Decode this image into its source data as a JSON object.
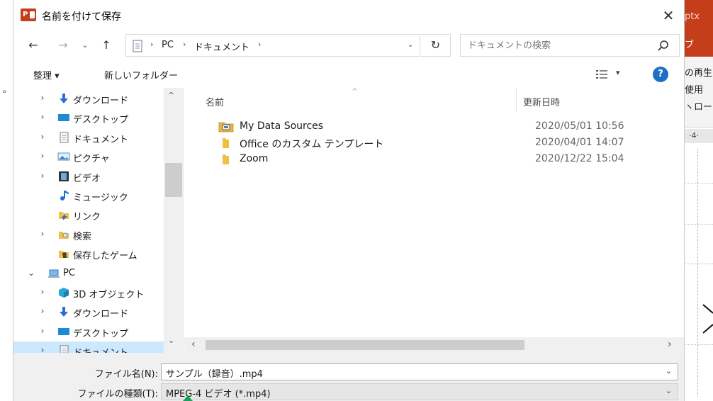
{
  "background_app": {
    "title_fragment": "ptx",
    "tab_fragment": "ブ",
    "ribbon_lines": [
      "の再生",
      "使用",
      "ヽロー"
    ],
    "ruler_text": "·4·",
    "left_edge_mark": "ᵒ"
  },
  "dialog": {
    "title": "名前を付けて保存",
    "app_logo_text": "P",
    "close_symbol": "✕"
  },
  "nav": {
    "back_symbol": "←",
    "forward_symbol": "→",
    "recent_symbol": "⌄",
    "up_symbol": "↑",
    "breadcrumb": [
      "PC",
      "ドキュメント"
    ],
    "breadcrumb_sep": "›",
    "address_dropdown": "⌄",
    "refresh_symbol": "↻",
    "search_placeholder": "ドキュメントの検索"
  },
  "toolbar": {
    "organize_label": "整理 ▾",
    "new_folder_label": "新しいフォルダー",
    "view_dropdown": "▾",
    "help_label": "?"
  },
  "tree": [
    {
      "label": "ダウンロード",
      "icon": "download-arrow-icon",
      "chevron": "›",
      "indent": 1
    },
    {
      "label": "デスクトップ",
      "icon": "desktop-icon",
      "chevron": "›",
      "indent": 1
    },
    {
      "label": "ドキュメント",
      "icon": "documents-icon",
      "chevron": "›",
      "indent": 1
    },
    {
      "label": "ピクチャ",
      "icon": "pictures-icon",
      "chevron": "›",
      "indent": 1
    },
    {
      "label": "ビデオ",
      "icon": "videos-icon",
      "chevron": "›",
      "indent": 1
    },
    {
      "label": "ミュージック",
      "icon": "music-icon",
      "chevron": "",
      "indent": 1
    },
    {
      "label": "リンク",
      "icon": "links-icon",
      "chevron": "",
      "indent": 1
    },
    {
      "label": "検索",
      "icon": "search-folder-icon",
      "chevron": "›",
      "indent": 1
    },
    {
      "label": "保存したゲーム",
      "icon": "saved-games-icon",
      "chevron": "",
      "indent": 1
    },
    {
      "label": "PC",
      "icon": "pc-icon",
      "chevron": "⌄",
      "indent": 0
    },
    {
      "label": "3D オブジェクト",
      "icon": "3d-objects-icon",
      "chevron": "›",
      "indent": 1
    },
    {
      "label": "ダウンロード",
      "icon": "download-arrow-icon",
      "chevron": "›",
      "indent": 1
    },
    {
      "label": "デスクトップ",
      "icon": "desktop-icon",
      "chevron": "›",
      "indent": 1
    },
    {
      "label": "ドキュメント",
      "icon": "documents-icon",
      "chevron": "›",
      "indent": 1,
      "selected": true
    }
  ],
  "nav_scroll": {
    "up": "^",
    "down": "⌄"
  },
  "file_list": {
    "sort_caret": "^",
    "columns": {
      "name": "名前",
      "date": "更新日時"
    },
    "rows": [
      {
        "name": "My Data Sources",
        "date": "2020/05/01 10:56",
        "icon": "data-sources-folder-icon"
      },
      {
        "name": "Office のカスタム テンプレート",
        "date": "2020/04/01 14:07",
        "icon": "folder-icon"
      },
      {
        "name": "Zoom",
        "date": "2020/12/22 15:04",
        "icon": "folder-icon"
      }
    ]
  },
  "h_scroll": {
    "left": "‹",
    "right": "›"
  },
  "form": {
    "filename_label": "ファイル名(N):",
    "filename_value": "サンプル（録音）.mp4",
    "filetype_label": "ファイルの種類(T):",
    "filetype_value": "MPEG-4 ビデオ (*.mp4)",
    "dropdown_symbol": "⌄"
  },
  "colors": {
    "powerpoint_accent": "#c43e1c",
    "selection": "#cce8ff",
    "help_blue": "#1e6fc8"
  }
}
